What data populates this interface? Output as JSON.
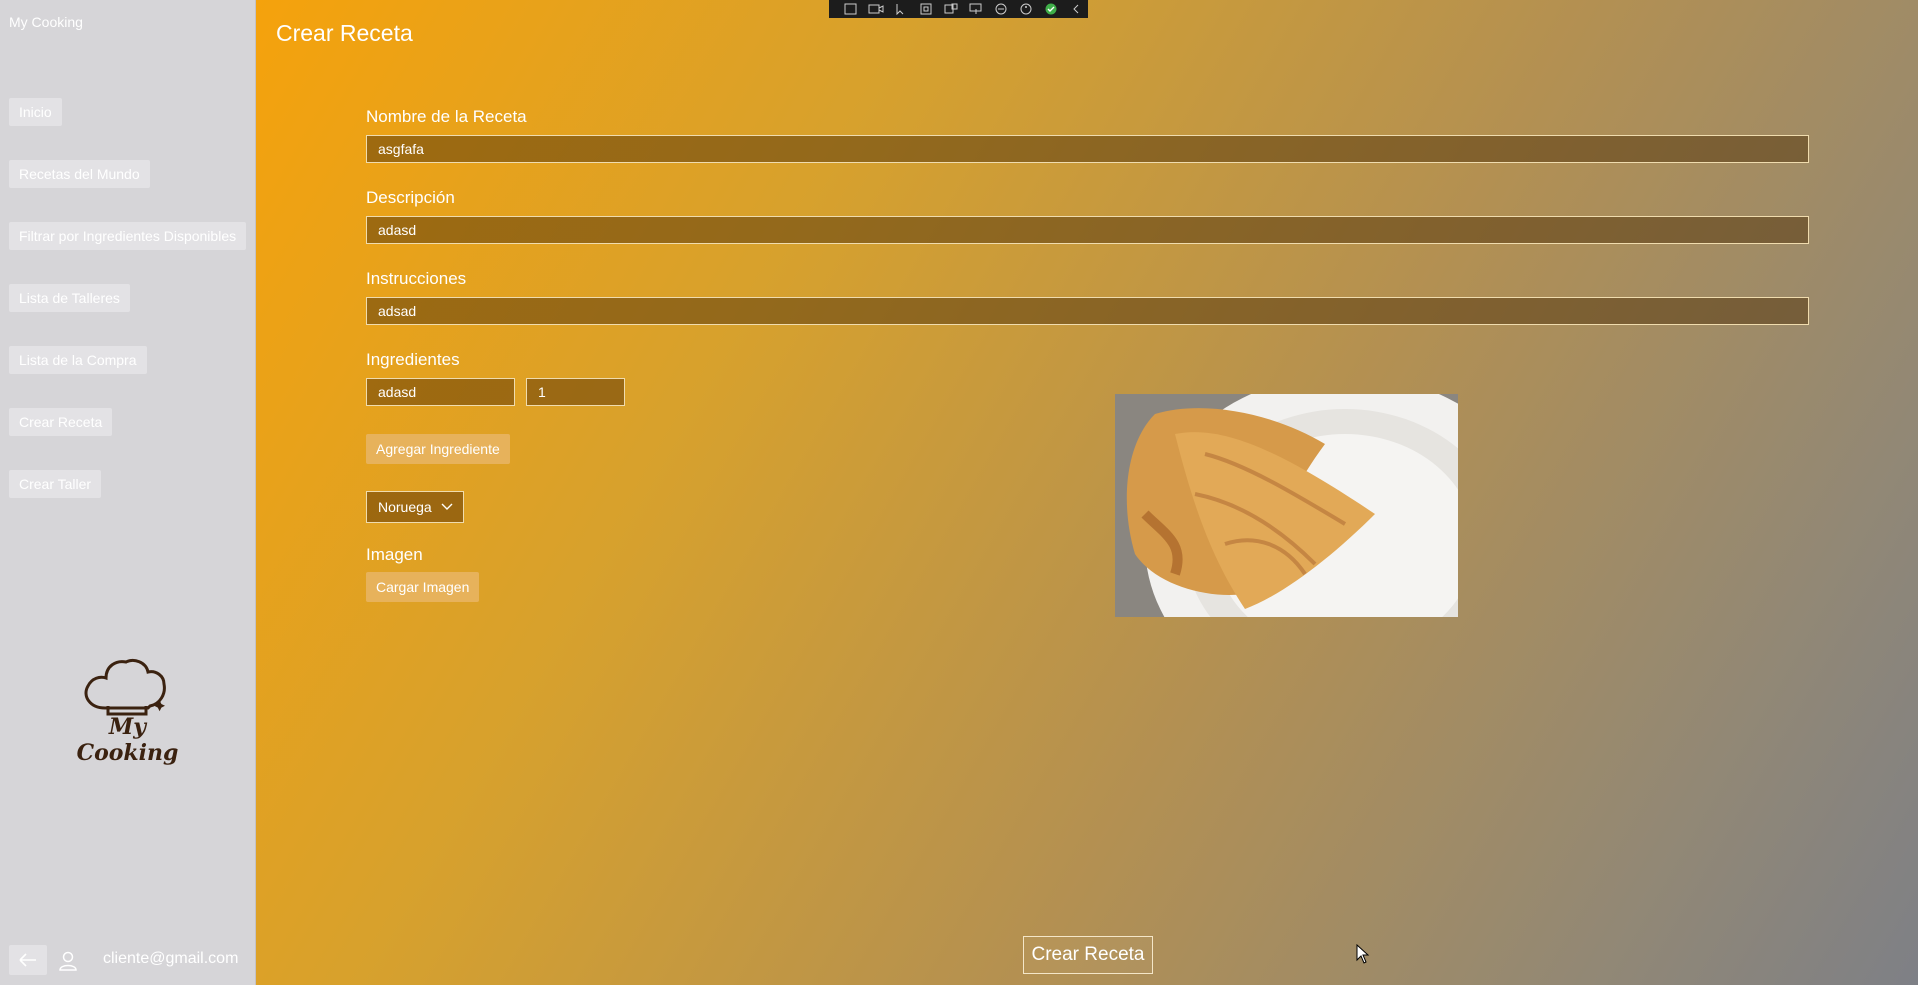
{
  "app": {
    "title": "My Cooking"
  },
  "sidebar": {
    "items": [
      {
        "label": "Inicio"
      },
      {
        "label": "Recetas del Mundo"
      },
      {
        "label": "Filtrar por Ingredientes Disponibles"
      },
      {
        "label": "Lista de Talleres"
      },
      {
        "label": "Lista de la Compra"
      },
      {
        "label": "Crear Receta"
      },
      {
        "label": "Crear Taller"
      }
    ],
    "logo_text": "My Cooking",
    "user_email": "cliente@gmail.com"
  },
  "page": {
    "title": "Crear Receta",
    "form": {
      "name": {
        "label": "Nombre de la Receta",
        "value": "asgfafa"
      },
      "description": {
        "label": "Descripción",
        "value": "adasd"
      },
      "instructions": {
        "label": "Instrucciones",
        "value": "adsad"
      },
      "ingredients": {
        "label": "Ingredientes",
        "name_value": "adasd",
        "quantity_value": "1",
        "add_button": "Agregar Ingrediente"
      },
      "country": {
        "selected": "Noruega"
      },
      "image": {
        "label": "Imagen",
        "upload_button": "Cargar Imagen"
      },
      "submit_button": "Crear Receta"
    }
  },
  "colors": {
    "sidebar_bg": "#d6d5d8",
    "accent_orange": "#f5a20c",
    "gradient_end": "#7e8086"
  },
  "icons": {
    "back": "back-arrow-icon",
    "user": "user-icon",
    "chef_hat": "chef-hat-icon"
  }
}
